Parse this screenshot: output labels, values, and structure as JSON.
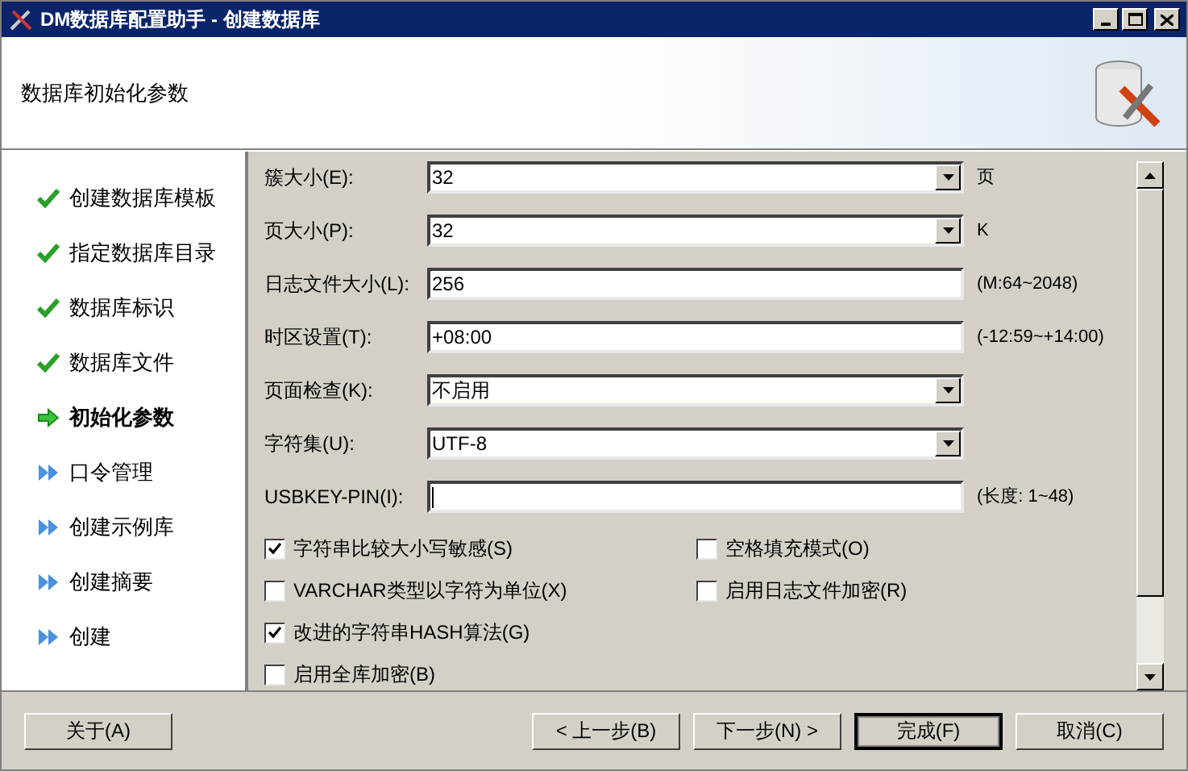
{
  "window": {
    "title": "DM数据库配置助手 - 创建数据库"
  },
  "header": {
    "title": "数据库初始化参数"
  },
  "steps": [
    {
      "label": "创建数据库模板",
      "kind": "done"
    },
    {
      "label": "指定数据库目录",
      "kind": "done"
    },
    {
      "label": "数据库标识",
      "kind": "done"
    },
    {
      "label": "数据库文件",
      "kind": "done"
    },
    {
      "label": "初始化参数",
      "kind": "current"
    },
    {
      "label": "口令管理",
      "kind": "pending"
    },
    {
      "label": "创建示例库",
      "kind": "pending"
    },
    {
      "label": "创建摘要",
      "kind": "pending"
    },
    {
      "label": "创建",
      "kind": "pending"
    }
  ],
  "fields": [
    {
      "label": "簇大小(E):",
      "kind": "combo",
      "value": "32",
      "suffix": "页"
    },
    {
      "label": "页大小(P):",
      "kind": "combo",
      "value": "32",
      "suffix": "K"
    },
    {
      "label": "日志文件大小(L):",
      "kind": "text",
      "value": "256",
      "suffix": "(M:64~2048)"
    },
    {
      "label": "时区设置(T):",
      "kind": "text",
      "value": "+08:00",
      "suffix": "(-12:59~+14:00)"
    },
    {
      "label": "页面检查(K):",
      "kind": "combo",
      "value": "不启用"
    },
    {
      "label": "字符集(U):",
      "kind": "combo",
      "value": "UTF-8"
    },
    {
      "label": "USBKEY-PIN(I):",
      "kind": "text",
      "suffix": "(长度: 1~48)"
    }
  ],
  "checkbox_rows": [
    [
      {
        "label": "字符串比较大小写敏感(S)",
        "checked": true
      },
      {
        "label": "空格填充模式(O)",
        "checked": false
      }
    ],
    [
      {
        "label": "VARCHAR类型以字符为单位(X)",
        "checked": false
      },
      {
        "label": "启用日志文件加密(R)",
        "checked": false
      }
    ],
    [
      {
        "label": "改进的字符串HASH算法(G)",
        "checked": true
      }
    ],
    [
      {
        "label": "启用全库加密(B)",
        "checked": false
      }
    ]
  ],
  "buttons": [
    {
      "label": "关于(A)",
      "default": false
    },
    {
      "label": "< 上一步(B)",
      "default": false
    },
    {
      "label": "下一步(N) >",
      "default": false
    },
    {
      "label": "完成(F)",
      "default": true
    },
    {
      "label": "取消(C)",
      "default": false
    }
  ]
}
